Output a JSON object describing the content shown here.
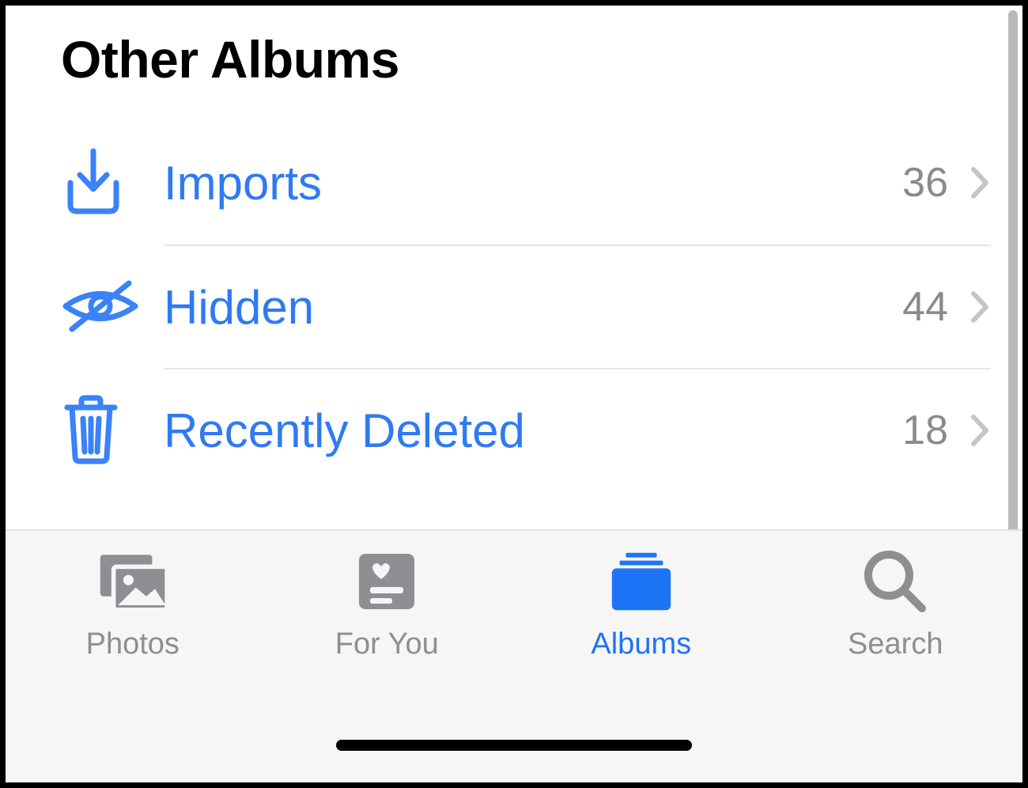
{
  "section_title": "Other Albums",
  "albums": [
    {
      "icon": "import-icon",
      "label": "Imports",
      "count": "36"
    },
    {
      "icon": "hidden-icon",
      "label": "Hidden",
      "count": "44"
    },
    {
      "icon": "trash-icon",
      "label": "Recently Deleted",
      "count": "18"
    }
  ],
  "tabs": {
    "photos": {
      "label": "Photos",
      "active": false
    },
    "for_you": {
      "label": "For You",
      "active": false
    },
    "albums": {
      "label": "Albums",
      "active": true
    },
    "search": {
      "label": "Search",
      "active": false
    }
  }
}
